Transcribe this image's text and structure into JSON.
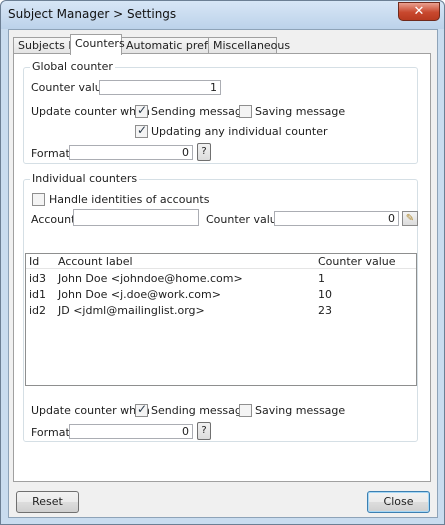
{
  "window": {
    "title": "Subject Manager > Settings",
    "close_glyph": "✕"
  },
  "tabs": [
    "Subjects list",
    "Counters",
    "Automatic prefixes",
    "Miscellaneous"
  ],
  "global": {
    "title": "Global counter",
    "counter_value_label": "Counter value",
    "counter_value": "1",
    "update_label": "Update counter when",
    "sending": "Sending message",
    "saving": "Saving message",
    "updating_any": "Updating any individual counter",
    "format_label": "Format",
    "format_value": "0",
    "format_help": "?"
  },
  "individual": {
    "title": "Individual counters",
    "handle_identities": "Handle identities of accounts",
    "account_label": "Account",
    "account_value": "",
    "counter_value_label": "Counter value",
    "counter_value": "0",
    "columns": [
      "Id",
      "Account label",
      "Counter value"
    ],
    "rows": [
      {
        "id": "id3",
        "label": "John Doe <johndoe@home.com>",
        "value": "1"
      },
      {
        "id": "id1",
        "label": "John Doe <j.doe@work.com>",
        "value": "10"
      },
      {
        "id": "id2",
        "label": "JD <jdml@mailinglist.org>",
        "value": "23"
      }
    ],
    "update_label": "Update counter when",
    "sending": "Sending message",
    "saving": "Saving message",
    "format_label": "Format",
    "format_value": "0",
    "format_help": "?"
  },
  "buttons": {
    "reset": "Reset",
    "close": "Close"
  },
  "checks": {
    "global_sending": true,
    "global_saving": false,
    "global_updating_any": true,
    "handle_identities": false,
    "ind_sending": true,
    "ind_saving": false
  }
}
